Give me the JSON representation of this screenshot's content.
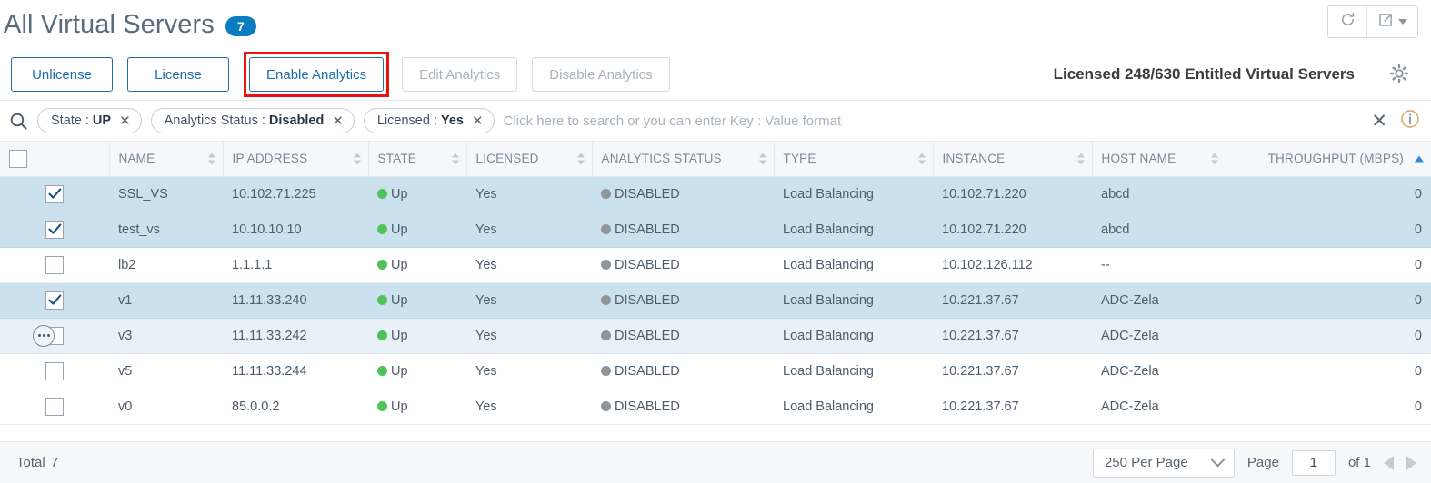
{
  "header": {
    "title": "All Virtual Servers",
    "count": "7",
    "refresh_icon": "refresh-icon",
    "export_icon": "export-icon"
  },
  "toolbar": {
    "buttons": [
      {
        "label": "Unlicense",
        "state": "enabled",
        "highlighted": false
      },
      {
        "label": "License",
        "state": "enabled",
        "highlighted": false
      },
      {
        "label": "Enable Analytics",
        "state": "enabled",
        "highlighted": true
      },
      {
        "label": "Edit Analytics",
        "state": "disabled",
        "highlighted": false
      },
      {
        "label": "Disable Analytics",
        "state": "disabled",
        "highlighted": false
      }
    ],
    "license_info": "Licensed 248/630 Entitled Virtual Servers",
    "settings_icon": "gear-icon"
  },
  "search": {
    "icon": "search-icon",
    "chips": [
      {
        "key": "State :",
        "value": "UP"
      },
      {
        "key": "Analytics Status :",
        "value": "Disabled"
      },
      {
        "key": "Licensed :",
        "value": "Yes"
      }
    ],
    "placeholder": "Click here to search or you can enter Key : Value format",
    "clear_label": "✕",
    "info_icon": "info-icon"
  },
  "table": {
    "columns": [
      {
        "label": "",
        "align": "center",
        "sort": "none"
      },
      {
        "label": "NAME",
        "align": "left",
        "sort": "both"
      },
      {
        "label": "IP ADDRESS",
        "align": "left",
        "sort": "both"
      },
      {
        "label": "STATE",
        "align": "left",
        "sort": "both"
      },
      {
        "label": "LICENSED",
        "align": "left",
        "sort": "both"
      },
      {
        "label": "ANALYTICS STATUS",
        "align": "left",
        "sort": "both"
      },
      {
        "label": "TYPE",
        "align": "left",
        "sort": "both"
      },
      {
        "label": "INSTANCE",
        "align": "left",
        "sort": "both"
      },
      {
        "label": "HOST NAME",
        "align": "left",
        "sort": "both"
      },
      {
        "label": "THROUGHPUT (MBPS)",
        "align": "right",
        "sort": "asc"
      }
    ],
    "header_checkbox_checked": false,
    "rows": [
      {
        "checked": true,
        "hovered": false,
        "name": "SSL_VS",
        "ip": "10.102.71.225",
        "state": "Up",
        "licensed": "Yes",
        "analytics": "DISABLED",
        "type": "Load Balancing",
        "instance": "10.102.71.220",
        "host": "abcd",
        "throughput": "0"
      },
      {
        "checked": true,
        "hovered": false,
        "name": "test_vs",
        "ip": "10.10.10.10",
        "state": "Up",
        "licensed": "Yes",
        "analytics": "DISABLED",
        "type": "Load Balancing",
        "instance": "10.102.71.220",
        "host": "abcd",
        "throughput": "0"
      },
      {
        "checked": false,
        "hovered": false,
        "name": "lb2",
        "ip": "1.1.1.1",
        "state": "Up",
        "licensed": "Yes",
        "analytics": "DISABLED",
        "type": "Load Balancing",
        "instance": "10.102.126.112",
        "host": "--",
        "throughput": "0"
      },
      {
        "checked": true,
        "hovered": false,
        "name": "v1",
        "ip": "11.11.33.240",
        "state": "Up",
        "licensed": "Yes",
        "analytics": "DISABLED",
        "type": "Load Balancing",
        "instance": "10.221.37.67",
        "host": "ADC-Zela",
        "throughput": "0"
      },
      {
        "checked": false,
        "hovered": true,
        "name": "v3",
        "ip": "11.11.33.242",
        "state": "Up",
        "licensed": "Yes",
        "analytics": "DISABLED",
        "type": "Load Balancing",
        "instance": "10.221.37.67",
        "host": "ADC-Zela",
        "throughput": "0"
      },
      {
        "checked": false,
        "hovered": false,
        "name": "v5",
        "ip": "11.11.33.244",
        "state": "Up",
        "licensed": "Yes",
        "analytics": "DISABLED",
        "type": "Load Balancing",
        "instance": "10.221.37.67",
        "host": "ADC-Zela",
        "throughput": "0"
      },
      {
        "checked": false,
        "hovered": false,
        "name": "v0",
        "ip": "85.0.0.2",
        "state": "Up",
        "licensed": "Yes",
        "analytics": "DISABLED",
        "type": "Load Balancing",
        "instance": "10.221.37.67",
        "host": "ADC-Zela",
        "throughput": "0"
      }
    ]
  },
  "footer": {
    "total_label": "Total",
    "total_value": "7",
    "per_page": "250 Per Page",
    "page_label": "Page",
    "page_value": "1",
    "of_label": "of 1"
  },
  "colors": {
    "accent": "#0a7cc1",
    "button_border": "#1f6ea8",
    "highlight": "#ee1111",
    "row_selected": "#cbe2ee",
    "row_hover": "#e8f0f8",
    "status_up": "#4fc35a",
    "status_disabled": "#8e959b"
  }
}
